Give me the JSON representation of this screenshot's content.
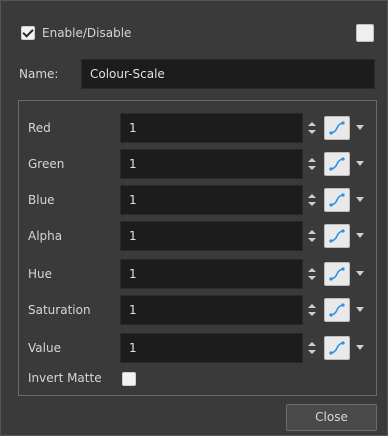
{
  "header": {
    "enable_label": "Enable/Disable",
    "enable_checked": true
  },
  "name": {
    "label": "Name:",
    "value": "Colour-Scale"
  },
  "params": [
    {
      "label": "Red",
      "value": "1"
    },
    {
      "label": "Green",
      "value": "1"
    },
    {
      "label": "Blue",
      "value": "1"
    },
    {
      "label": "Alpha",
      "value": "1"
    },
    {
      "label": "Hue",
      "value": "1"
    },
    {
      "label": "Saturation",
      "value": "1"
    },
    {
      "label": "Value",
      "value": "1"
    }
  ],
  "invert": {
    "label": "Invert Matte",
    "checked": false
  },
  "footer": {
    "close_label": "Close"
  },
  "icons": {
    "spin": "spinner-arrows-icon",
    "function": "function-curve-icon",
    "dropdown": "dropdown-arrow-icon"
  },
  "colors": {
    "accent": "#2b8fe3",
    "field_bg": "#1c1c1c",
    "panel_bg": "#3a3a3a"
  }
}
